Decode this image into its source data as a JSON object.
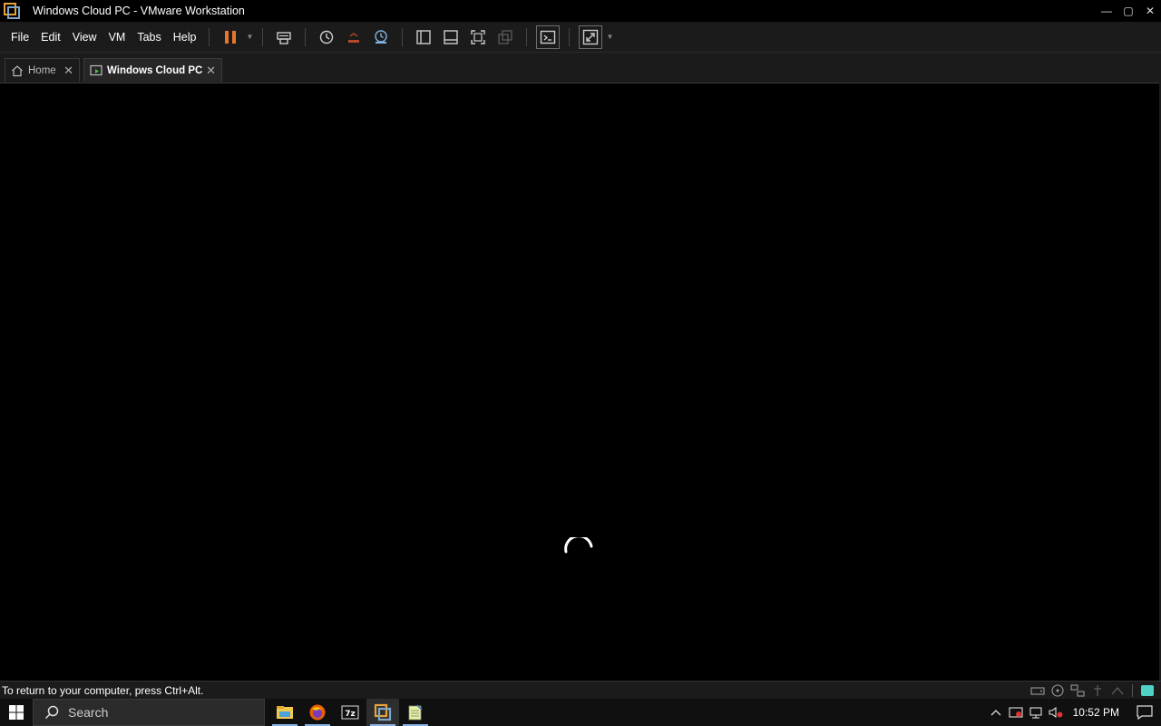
{
  "window": {
    "title": "Windows Cloud PC - VMware Workstation",
    "controls": {
      "minimize": "—",
      "maximize": "▢",
      "close": "✕"
    }
  },
  "menu": {
    "items": [
      "File",
      "Edit",
      "View",
      "VM",
      "Tabs",
      "Help"
    ]
  },
  "toolbar": {
    "icons": [
      "pause-icon",
      "send-ctrl-alt-del-icon",
      "snapshot-icon",
      "revert-snapshot-icon",
      "snapshot-manager-icon",
      "show-library-icon",
      "thumbnail-bar-icon",
      "full-screen-icon",
      "unity-icon",
      "console-view-icon",
      "stretch-guest-icon"
    ],
    "accent": "#e8772e"
  },
  "tabs": [
    {
      "label": "Home",
      "close": "✕"
    },
    {
      "label": "Windows Cloud PC",
      "close": "✕"
    }
  ],
  "status": {
    "message": "To return to your computer, press Ctrl+Alt."
  },
  "taskbar": {
    "search_placeholder": "Search",
    "apps": [
      "file-explorer-icon",
      "firefox-icon",
      "7zip-icon",
      "vmware-icon",
      "notepad-icon"
    ],
    "clock": "10:52 PM"
  }
}
